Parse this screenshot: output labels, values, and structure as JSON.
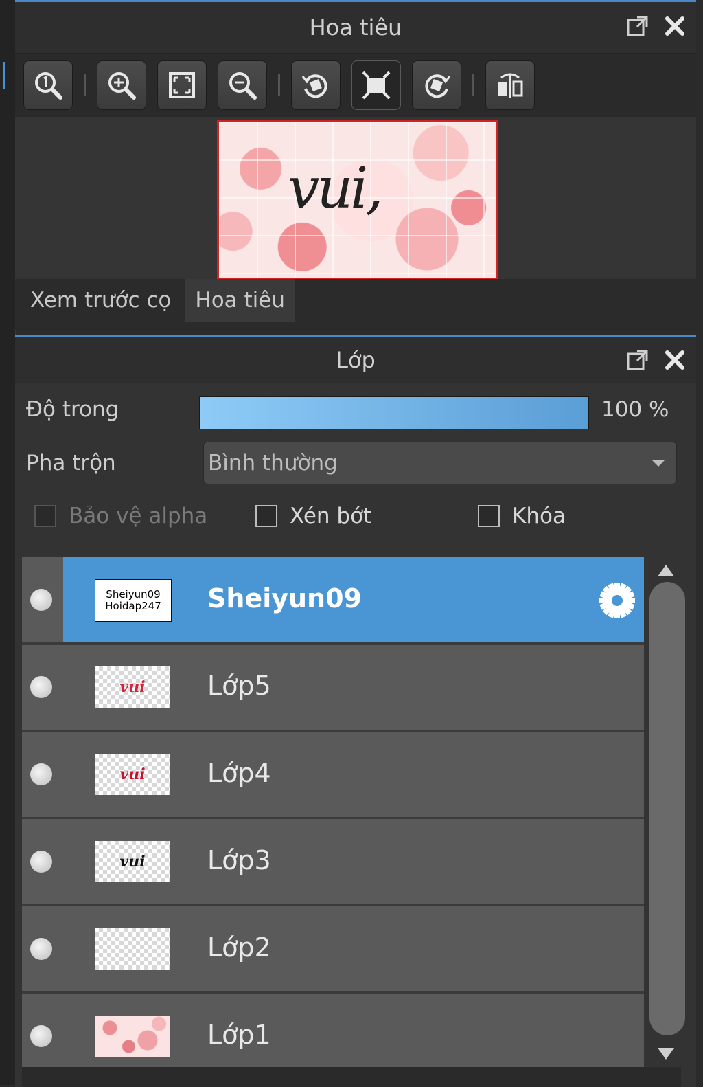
{
  "navigator": {
    "title": "Hoa tiêu",
    "toolbar": [
      {
        "name": "zoom-actual-size-button",
        "icon": "zoom-actual-icon"
      },
      {
        "name": "zoom-in-button",
        "icon": "zoom-in-icon"
      },
      {
        "name": "fit-to-window-button",
        "icon": "fit-window-icon"
      },
      {
        "name": "zoom-out-button",
        "icon": "zoom-out-icon"
      },
      {
        "name": "rotate-left-button",
        "icon": "rotate-left-icon"
      },
      {
        "name": "fit-canvas-button",
        "icon": "fit-canvas-icon",
        "active": true
      },
      {
        "name": "rotate-right-button",
        "icon": "rotate-right-icon"
      },
      {
        "name": "flip-horizontal-button",
        "icon": "flip-icon"
      }
    ],
    "tabs": [
      "Xem trước cọ",
      "Hoa tiêu"
    ],
    "active_tab": "Hoa tiêu",
    "preview_text": "vui,"
  },
  "layers": {
    "title": "Lớp",
    "opacity_label": "Độ trong",
    "opacity_value": "100 %",
    "opacity_fraction": 1.0,
    "blend_label": "Pha trộn",
    "blend_value": "Bình thường",
    "checkboxes": {
      "protect_alpha": "Bảo vệ alpha",
      "clipping": "Xén bớt",
      "lock": "Khóa"
    },
    "items": [
      {
        "name": "Sheiyun09",
        "thumb": "text",
        "thumb_line1": "Sheiyun09",
        "thumb_line2": "Hoidap247",
        "selected": true
      },
      {
        "name": "Lớp5",
        "thumb": "vui",
        "thumb_text": "vui",
        "thumb_color": "#d4203a"
      },
      {
        "name": "Lớp4",
        "thumb": "vui",
        "thumb_text": "vui",
        "thumb_color": "#c8102e"
      },
      {
        "name": "Lớp3",
        "thumb": "vui",
        "thumb_text": "vui",
        "thumb_color": "#111111"
      },
      {
        "name": "Lớp2",
        "thumb": "empty"
      },
      {
        "name": "Lớp1",
        "thumb": "floral"
      }
    ]
  },
  "colors": {
    "accent": "#4a95d4",
    "panel_border": "#4a88c7",
    "frame_red": "#d42222"
  }
}
